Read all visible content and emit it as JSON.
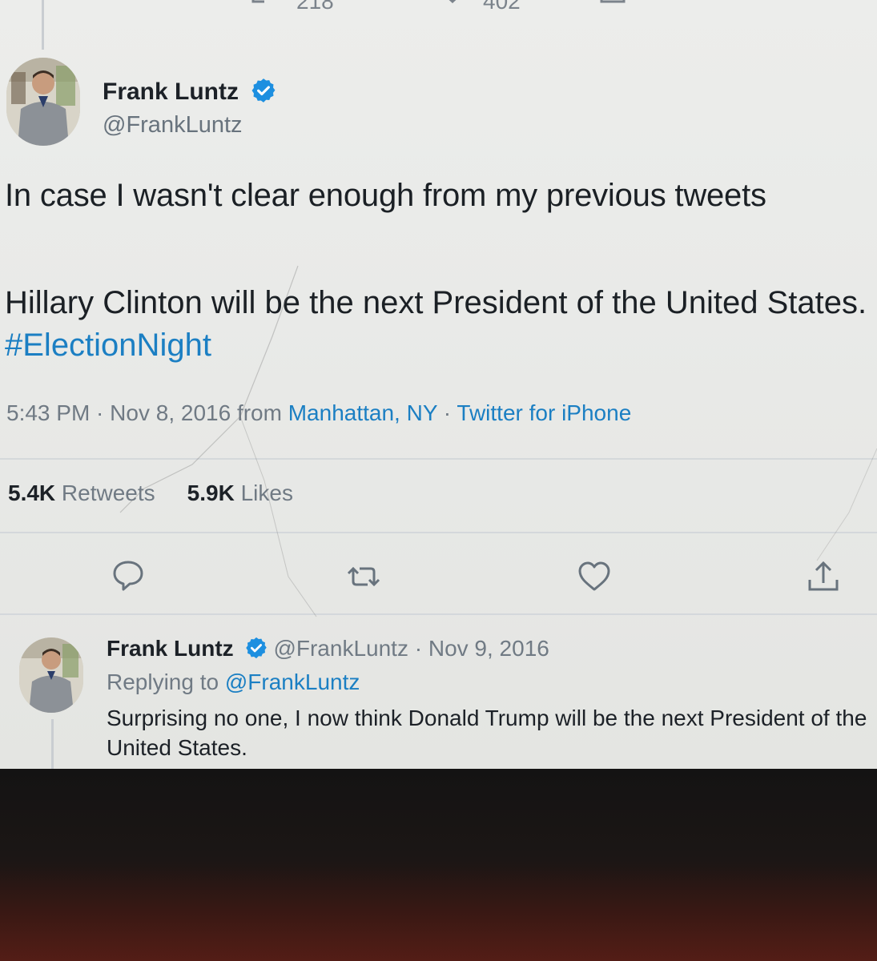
{
  "top_actions": {
    "retweet_count_partial": "218",
    "like_count_partial": "402"
  },
  "main_tweet": {
    "author_name": "Frank Luntz",
    "author_handle": "@FrankLuntz",
    "text_line1": "In case I wasn't clear enough from my previous tweets",
    "text_line2": "Hillary Clinton will be the next President of the United States. ",
    "hashtag": "#ElectionNight",
    "time": "5:43 PM",
    "sep1": " · ",
    "date": "Nov 8, 2016",
    "from_label": " from ",
    "location": "Manhattan, NY",
    "sep2": " · ",
    "source": "Twitter for iPhone",
    "retweets_count": "5.4K",
    "retweets_label": " Retweets",
    "likes_count": "5.9K",
    "likes_label": " Likes"
  },
  "reply_tweet": {
    "author_name": "Frank Luntz",
    "author_handle": "@FrankLuntz",
    "sep": " · ",
    "date": "Nov 9, 2016",
    "replying_prefix": "Replying to ",
    "replying_to": "@FrankLuntz",
    "text": "Surprising no one, I now think Donald Trump will be the next President of the United States."
  },
  "icons": {
    "reply": "reply-icon",
    "retweet": "retweet-icon",
    "like": "heart-icon",
    "share": "share-icon",
    "verified": "verified-badge-icon"
  },
  "colors": {
    "link_blue": "#1b7fc3",
    "verified_blue": "#1d8fe0",
    "text_dark": "#1c2127",
    "text_gray": "#707a84"
  }
}
